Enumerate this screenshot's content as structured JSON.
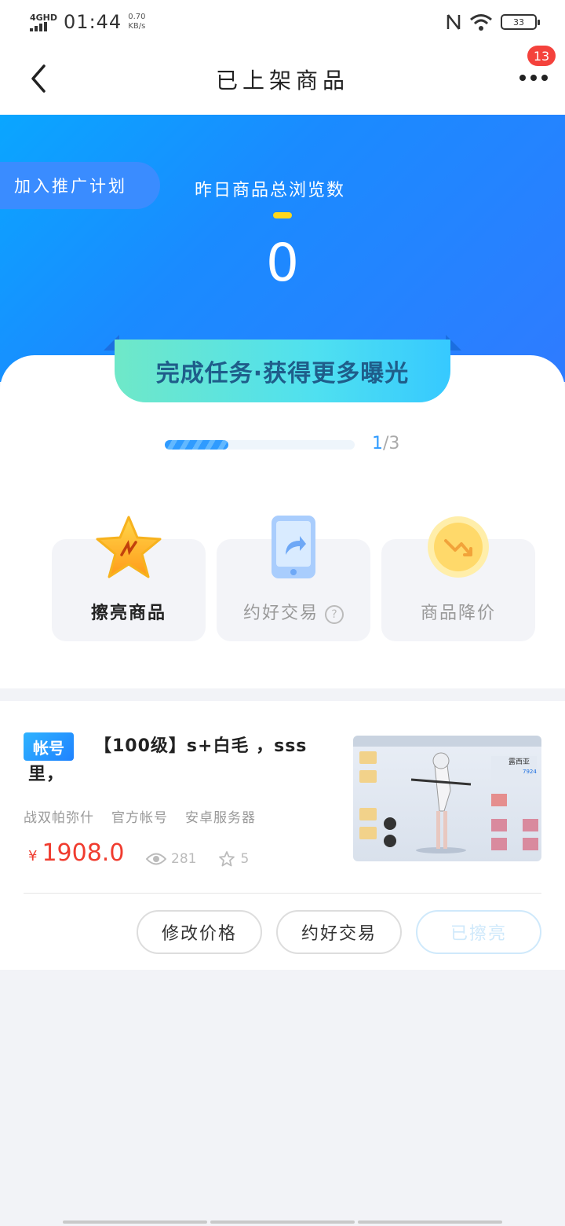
{
  "status_bar": {
    "network": "4GHD",
    "time": "01:44",
    "speed_value": "0.70",
    "speed_unit": "KB/s",
    "battery": "33"
  },
  "nav": {
    "title": "已上架商品",
    "badge_count": "13"
  },
  "hero": {
    "join_label": "加入推广计划",
    "views_label": "昨日商品总浏览数",
    "views_value": "0"
  },
  "tasks": {
    "banner": "完成任务·获得更多曝光",
    "progress_current": "1",
    "progress_total": "/3",
    "progress_fraction": 0.333,
    "items": [
      {
        "label": "擦亮商品",
        "icon": "star-icon"
      },
      {
        "label": "约好交易",
        "icon": "phone-share-icon"
      },
      {
        "label": "商品降价",
        "icon": "price-down-coin-icon"
      }
    ]
  },
  "product": {
    "tag": "帐号",
    "title": "【100级】s+白毛 ，sss里，",
    "meta": [
      "战双帕弥什",
      "官方帐号",
      "安卓服务器"
    ],
    "currency": "¥",
    "price": "1908.0",
    "views": "281",
    "favorites": "5",
    "thumb_name": "露西亚",
    "thumb_stat": "7924",
    "actions": {
      "modify_price": "修改价格",
      "arrange_trade": "约好交易",
      "polished": "已擦亮"
    }
  }
}
